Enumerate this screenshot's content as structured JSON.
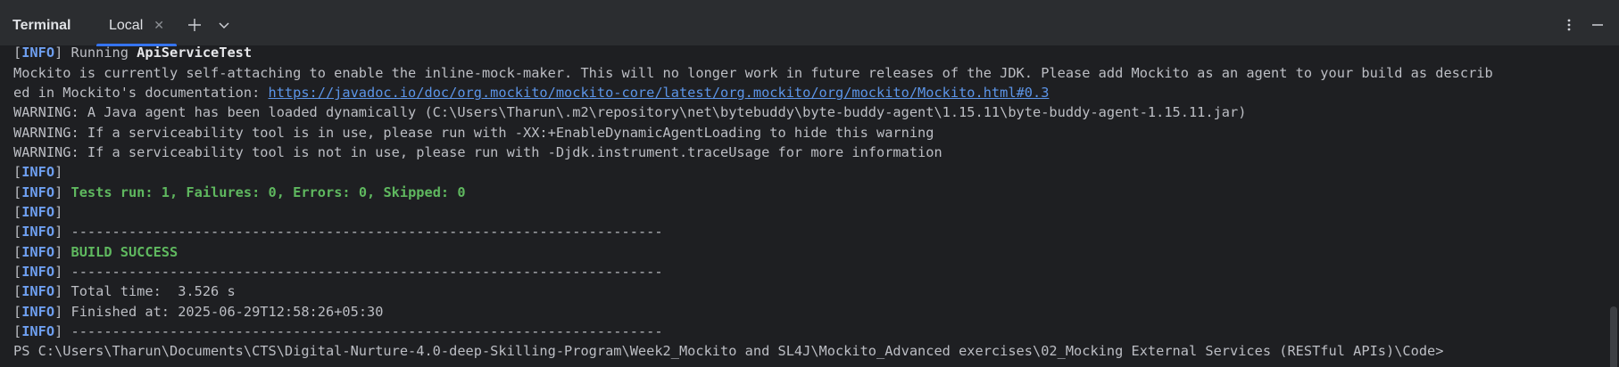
{
  "window": {
    "panel_title": "Terminal",
    "tabs": [
      {
        "label": "Local",
        "active": true
      }
    ]
  },
  "icons": {
    "close_tab": "close-icon",
    "new_tab": "plus-icon",
    "tab_dropdown": "chevron-down-icon",
    "options": "more-vertical-icon",
    "hide": "minimize-icon"
  },
  "colors": {
    "background": "#1e1f22",
    "toolbar": "#2b2d30",
    "accent": "#3574f0",
    "info_tag": "#6e9ff0",
    "success_green": "#5fb85f",
    "link": "#5c95e8"
  },
  "terminal": {
    "info_tag": "INFO",
    "lines": {
      "running_prefix": "Running ",
      "running_class": "ApiServiceTest",
      "mockito_1": "Mockito is currently self-attaching to enable the inline-mock-maker. This will no longer work in future releases of the JDK. Please add Mockito as an agent to your build as describ",
      "mockito_2_prefix": "ed in Mockito's documentation: ",
      "mockito_2_link": "https://javadoc.io/doc/org.mockito/mockito-core/latest/org.mockito/org/mockito/Mockito.html#0.3",
      "warning_1": "WARNING: A Java agent has been loaded dynamically (C:\\Users\\Tharun\\.m2\\repository\\net\\bytebuddy\\byte-buddy-agent\\1.15.11\\byte-buddy-agent-1.15.11.jar)",
      "warning_2": "WARNING: If a serviceability tool is in use, please run with -XX:+EnableDynamicAgentLoading to hide this warning",
      "warning_3": "WARNING: If a serviceability tool is not in use, please run with -Djdk.instrument.traceUsage for more information",
      "tests_run": "Tests run: 1, Failures: 0, Errors: 0, Skipped: 0",
      "separator": "------------------------------------------------------------------------",
      "build_success": "BUILD SUCCESS",
      "total_time": "Total time:  3.526 s",
      "finished_at": "Finished at: 2025-06-29T12:58:26+05:30",
      "prompt": "PS C:\\Users\\Tharun\\Documents\\CTS\\Digital-Nurture-4.0-deep-Skilling-Program\\Week2_Mockito and SL4J\\Mockito_Advanced exercises\\02_Mocking External Services (RESTful APIs)\\Code>"
    }
  }
}
